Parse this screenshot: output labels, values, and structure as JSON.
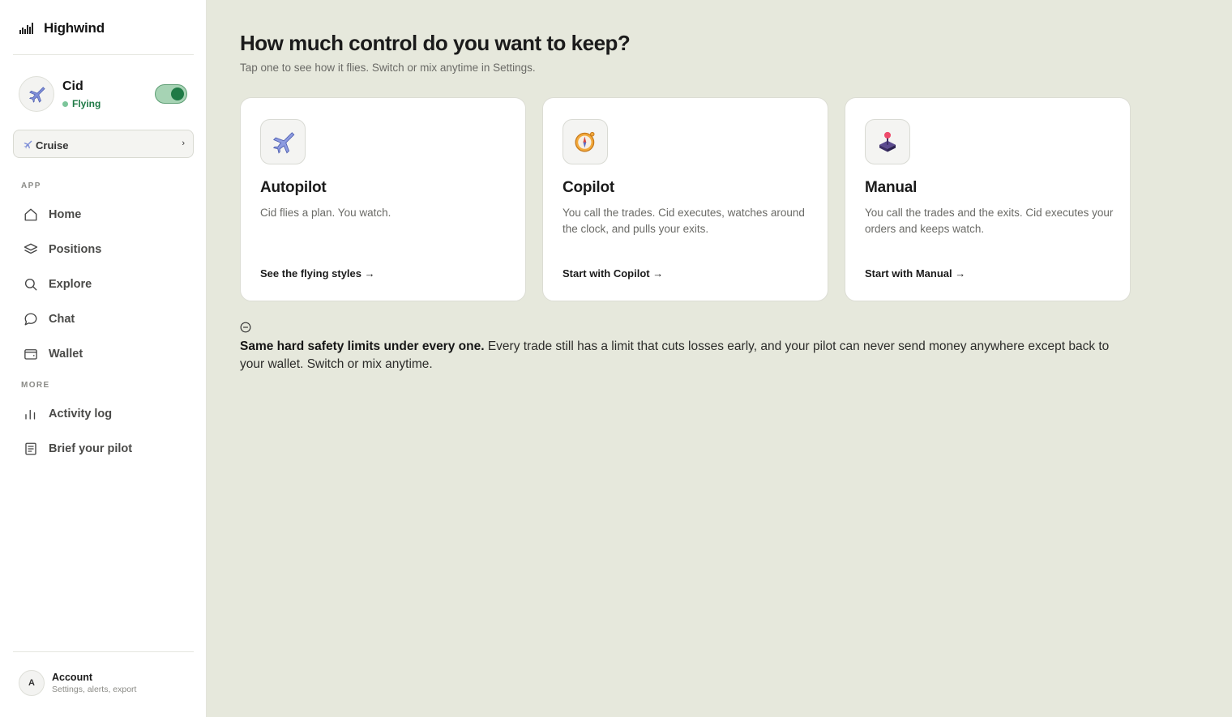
{
  "app": {
    "name": "Highwind"
  },
  "pilot": {
    "name": "Cid",
    "status": "Flying",
    "toggle_on": true
  },
  "mode_select": {
    "value": "Cruise"
  },
  "nav": {
    "app_section_label": "APP",
    "app_items": [
      {
        "label": "Home",
        "icon": "home-icon"
      },
      {
        "label": "Positions",
        "icon": "layers-icon"
      },
      {
        "label": "Explore",
        "icon": "search-icon"
      },
      {
        "label": "Chat",
        "icon": "chat-bubble-icon"
      },
      {
        "label": "Wallet",
        "icon": "wallet-icon"
      }
    ],
    "more_section_label": "MORE",
    "more_items": [
      {
        "label": "Activity log",
        "icon": "bar-chart-icon"
      },
      {
        "label": "Brief your pilot",
        "icon": "document-icon"
      }
    ]
  },
  "account": {
    "avatar_letter": "A",
    "title": "Account",
    "subtitle": "Settings, alerts, export"
  },
  "main": {
    "title": "How much control do you want to keep?",
    "subtitle": "Tap one to see how it flies. Switch or mix anytime in Settings.",
    "cards": [
      {
        "title": "Autopilot",
        "description": "Cid flies a plan. You watch.",
        "link": "See the flying styles →",
        "icon": "airplane-icon"
      },
      {
        "title": "Copilot",
        "description": "You call the trades. Cid executes, watches around the clock, and pulls your exits.",
        "link": "Start with Copilot →",
        "icon": "compass-icon"
      },
      {
        "title": "Manual",
        "description": "You call the trades and the exits. Cid executes your orders and keeps watch.",
        "link": "Start with Manual →",
        "icon": "joystick-icon"
      }
    ],
    "safety": {
      "icon": "minus-circle-icon",
      "bold": "Same hard safety limits under every one.",
      "text": " Every trade still has a limit that cuts losses early, and your pilot can never send money anywhere except back to your wallet. Switch or mix anytime."
    }
  },
  "colors": {
    "accent_green": "#1f7a46",
    "toggle_bg": "#a6d3b4",
    "page_bg": "#e6e8dc"
  }
}
